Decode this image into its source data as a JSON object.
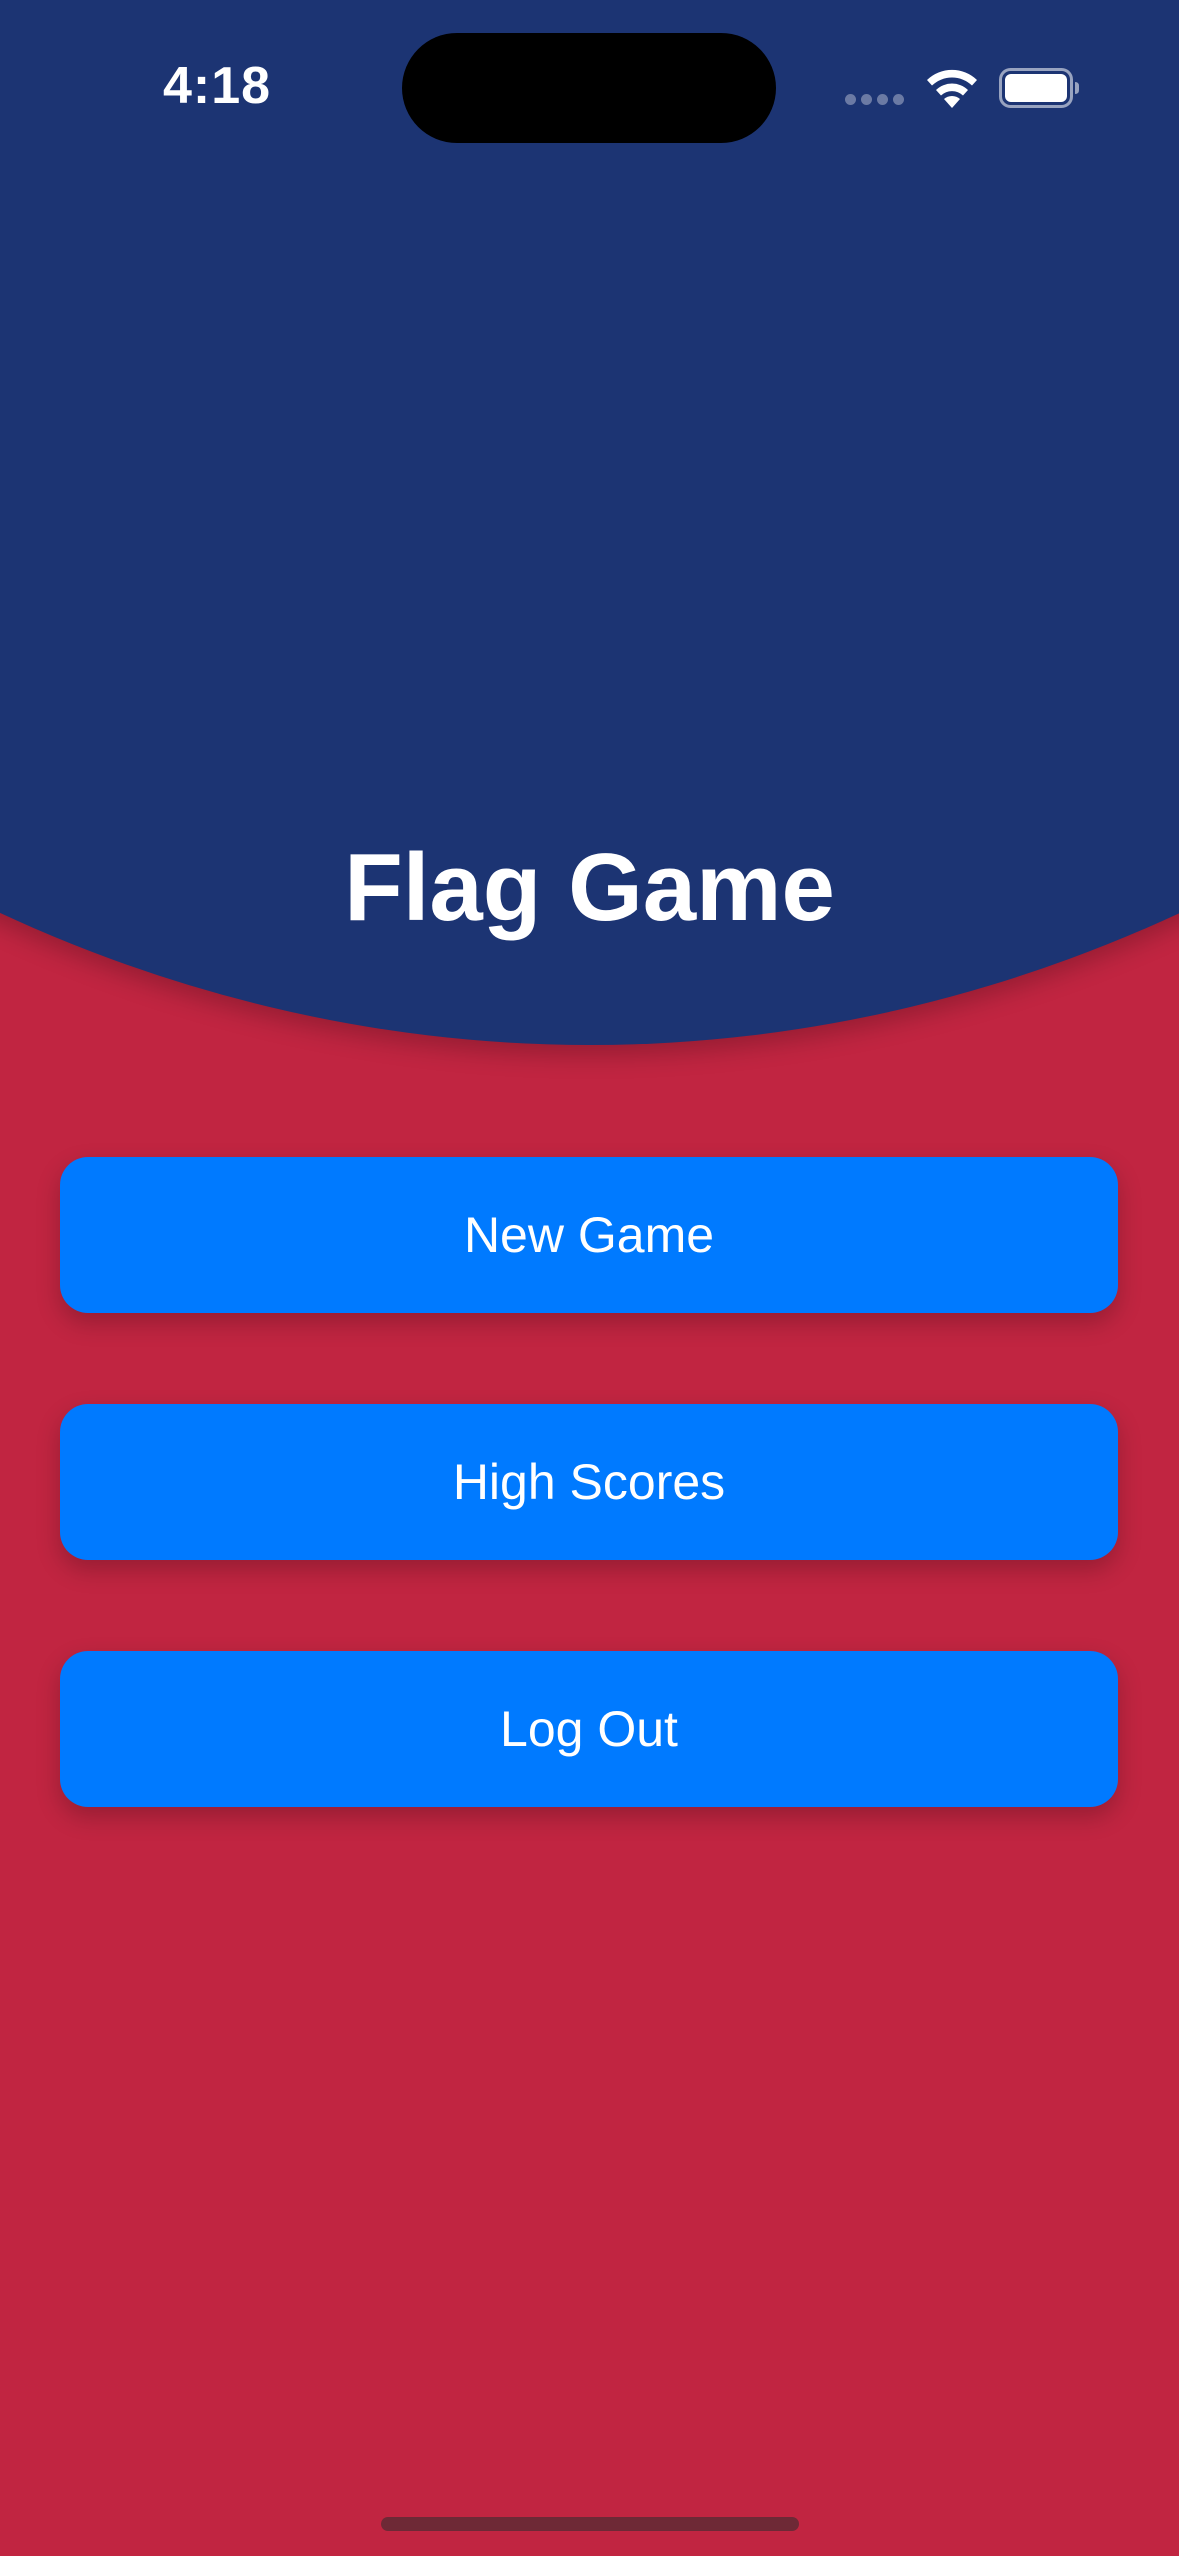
{
  "status_bar": {
    "time": "4:18",
    "icons": [
      "cellular-signal-icon",
      "wifi-icon",
      "battery-icon"
    ]
  },
  "app": {
    "title": "Flag Game"
  },
  "menu": {
    "buttons": [
      {
        "label": "New Game"
      },
      {
        "label": "High Scores"
      },
      {
        "label": "Log Out"
      }
    ]
  },
  "colors": {
    "header_blue": "#1C3473",
    "background_red": "#C12541",
    "button_blue": "#007AFF",
    "text_white": "#FFFFFF"
  }
}
